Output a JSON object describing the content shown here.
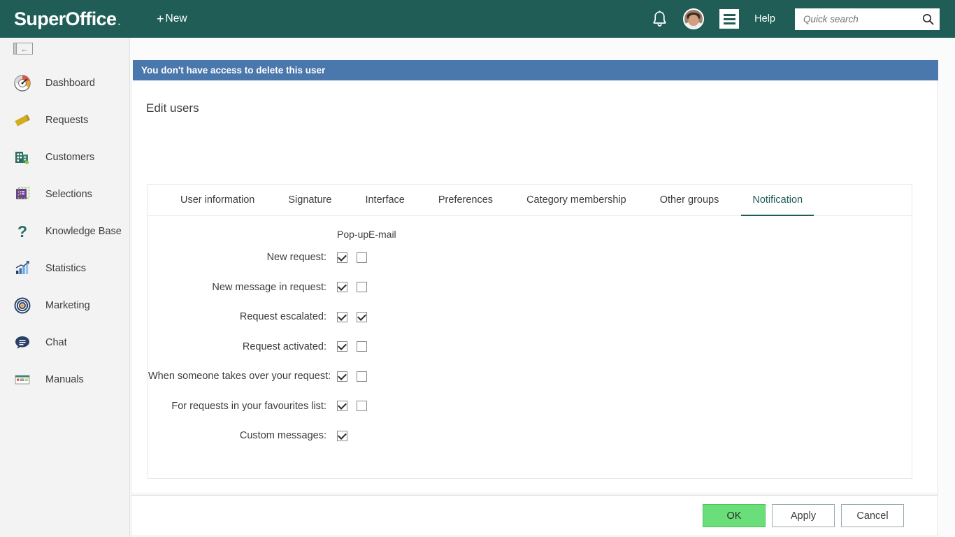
{
  "colors": {
    "header_teal": "#1f5d56",
    "banner_blue": "#4a77ac",
    "ok_green": "#6ade78",
    "sidebar_bg": "#f3f3f4",
    "text": "#3c3c3c"
  },
  "header": {
    "logo": "SuperOffice",
    "logo_mark": ".",
    "new_label": "New",
    "new_plus": "+",
    "help_label": "Help",
    "bell_icon": "bell-icon",
    "avatar_icon": "user-avatar",
    "menu_icon": "hamburger-menu-icon",
    "search": {
      "placeholder": "Quick search",
      "value": "",
      "icon": "search-icon"
    }
  },
  "sidebar": {
    "collapse_icon": "collapse-panel-icon",
    "collapse_arrow": "←",
    "items": [
      {
        "label": "Dashboard",
        "icon": "dashboard-gauge-icon"
      },
      {
        "label": "Requests",
        "icon": "ticket-icon"
      },
      {
        "label": "Customers",
        "icon": "building-icon"
      },
      {
        "label": "Selections",
        "icon": "selection-square-icon"
      },
      {
        "label": "Knowledge Base",
        "icon": "question-mark-icon"
      },
      {
        "label": "Statistics",
        "icon": "bar-chart-icon"
      },
      {
        "label": "Marketing",
        "icon": "target-icon"
      },
      {
        "label": "Chat",
        "icon": "chat-bubble-icon"
      },
      {
        "label": "Manuals",
        "icon": "manuals-icon"
      }
    ]
  },
  "main": {
    "banner_text": "You don't have access to delete this user",
    "page_title": "Edit users",
    "tabs": [
      {
        "label": "User information",
        "active": false
      },
      {
        "label": "Signature",
        "active": false
      },
      {
        "label": "Interface",
        "active": false
      },
      {
        "label": "Preferences",
        "active": false
      },
      {
        "label": "Category membership",
        "active": false
      },
      {
        "label": "Other groups",
        "active": false
      },
      {
        "label": "Notification",
        "active": true
      }
    ],
    "notification": {
      "column_headers": {
        "popup": "Pop-up",
        "email": "E-mail"
      },
      "rows": [
        {
          "label": "New request:",
          "popup": true,
          "email": false,
          "email_present": true
        },
        {
          "label": "New message in request:",
          "popup": true,
          "email": false,
          "email_present": true
        },
        {
          "label": "Request escalated:",
          "popup": true,
          "email": true,
          "email_present": true
        },
        {
          "label": "Request activated:",
          "popup": true,
          "email": false,
          "email_present": true
        },
        {
          "label": "When someone takes over your request:",
          "popup": true,
          "email": false,
          "email_present": true
        },
        {
          "label": "For requests in your favourites list:",
          "popup": true,
          "email": false,
          "email_present": true
        },
        {
          "label": "Custom messages:",
          "popup": true,
          "email": false,
          "email_present": false
        }
      ]
    },
    "footer": {
      "ok": "OK",
      "apply": "Apply",
      "cancel": "Cancel"
    }
  }
}
